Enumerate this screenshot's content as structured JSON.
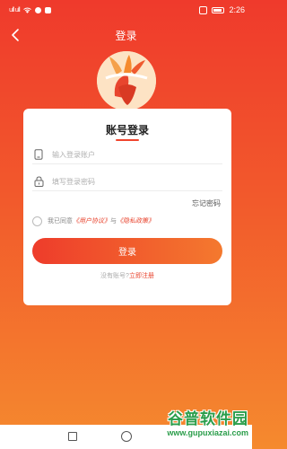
{
  "status": {
    "signal": "ull ull",
    "time": "2:26"
  },
  "nav": {
    "title": "登录"
  },
  "form": {
    "title": "账号登录",
    "account_placeholder": "输入登录账户",
    "password_placeholder": "填写登录密码",
    "forgot": "忘记密码",
    "agree_prefix": "我已同意",
    "user_agreement": "《用户协议》",
    "agree_and": "与",
    "privacy_policy": "《隐私政策》",
    "login_button": "登录",
    "no_account": "没有账号?",
    "register_link": "立即注册"
  },
  "watermark": {
    "main": "谷普软件园",
    "url": "www.gupuxiazai.com"
  },
  "colors": {
    "accent": "#ef3a2c",
    "gradient_end": "#f58a2e",
    "link": "#e8432d"
  }
}
